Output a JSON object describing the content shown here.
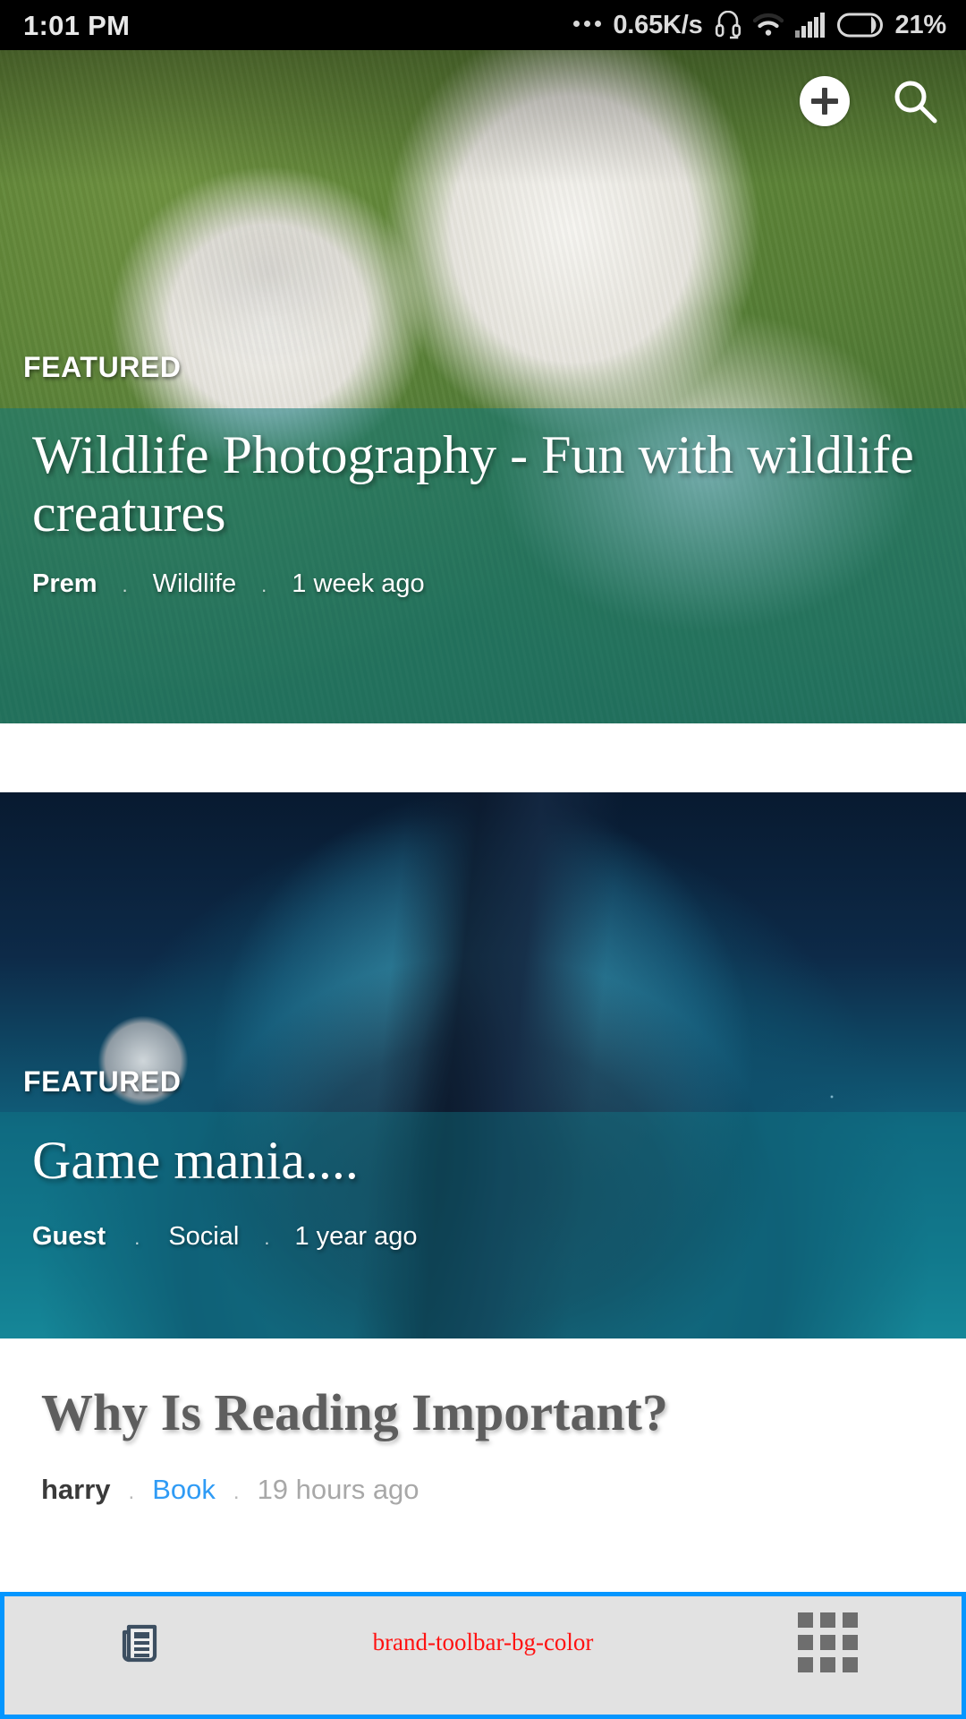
{
  "status_bar": {
    "time": "1:01 PM",
    "network_speed": "0.65K/s",
    "battery_percent": "21%",
    "icons": [
      "more-dots-icon",
      "headset-icon",
      "wifi-icon",
      "cellular-signal-icon",
      "battery-icon"
    ]
  },
  "top_actions": {
    "add_label": "+",
    "add_icon": "plus-icon",
    "search_icon": "search-icon"
  },
  "feed": {
    "cards": [
      {
        "badge": "FEATURED",
        "title": "Wildlife Photography - Fun with wildlife creatures",
        "author": "Prem",
        "category": "Wildlife",
        "time": "1 week ago",
        "separator": "."
      },
      {
        "badge": "FEATURED",
        "title": "Game mania....",
        "author": "Guest",
        "category": "Social",
        "time": "1 year ago",
        "separator": "."
      }
    ],
    "items": [
      {
        "title": "Why Is Reading Important?",
        "author": "harry",
        "category": "Book",
        "time": "19 hours ago",
        "separator": "."
      }
    ]
  },
  "bottom_toolbar": {
    "news_icon": "newspaper-icon",
    "label": "brand-toolbar-bg-color",
    "grid_icon": "grid-apps-icon"
  },
  "colors": {
    "toolbar_border": "#0596ff",
    "toolbar_bg": "#e2e2e2",
    "toolbar_label": "#ff1111",
    "category_link": "#2f9bf5",
    "status_bar_bg": "#000000"
  }
}
